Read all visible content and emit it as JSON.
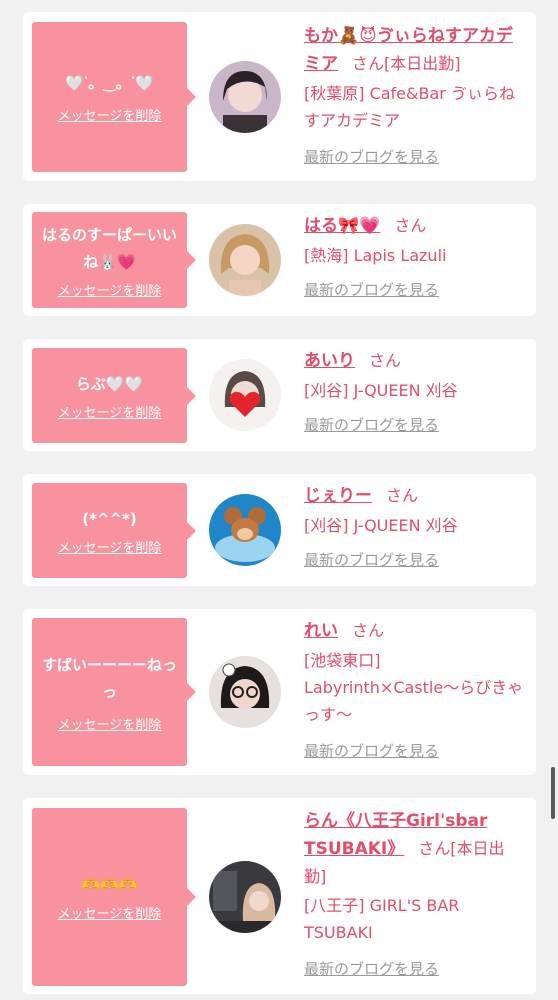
{
  "delete_label": "メッセージを削除",
  "blog_label": "最新のブログを見る",
  "suffix": "さん",
  "cards": [
    {
      "message": "🤍ᐝ。‿。ᐝ🤍",
      "name": "もか🧸😈ゔぃらねすアカデミア",
      "status": "[本日出勤]",
      "shop": "[秋葉原] Cafe&Bar ゔぃらねすアカデミア",
      "avatar": "avatar-girl-dark-hair"
    },
    {
      "message": "はるのすーぱーいいね🐰💗",
      "name": "はる🎀💗",
      "status": "",
      "shop": "[熱海] Lapis Lazuli",
      "avatar": "avatar-girl-blonde"
    },
    {
      "message": "らぶ🤍🤍",
      "name": "あいり",
      "status": "",
      "shop": "[刈谷] J-QUEEN 刈谷",
      "avatar": "avatar-girl-heart"
    },
    {
      "message": "(*^^*)",
      "name": "じぇりー",
      "status": "",
      "shop": "[刈谷] J-QUEEN 刈谷",
      "avatar": "avatar-cartoon-mouse"
    },
    {
      "message": "すばいーーーーねっっ",
      "name": "れい",
      "status": "",
      "shop": "[池袋東口] Labyrinth×Castle〜らびきゃっす〜",
      "avatar": "avatar-girl-glasses"
    },
    {
      "message": "🫶🫶🫶",
      "name": "らん《八王子Girl'sbar TSUBAKI》",
      "status": "[本日出勤]",
      "shop": "[八王子] GIRL'S BAR TSUBAKI",
      "avatar": "avatar-girl-bar"
    }
  ]
}
